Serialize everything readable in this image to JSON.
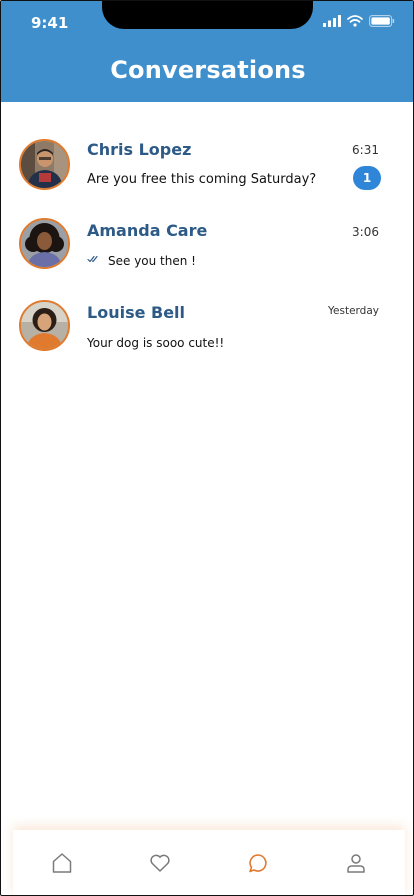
{
  "status_bar": {
    "time": "9:41"
  },
  "header": {
    "title": "Conversations"
  },
  "conversations": [
    {
      "name": "Chris Lopez",
      "message": "Are you free this coming Saturday?",
      "time": "6:31",
      "unread": "1"
    },
    {
      "name": "Amanda Care",
      "message": "See you then !",
      "time": "3:06",
      "read_receipt": "double-check-icon"
    },
    {
      "name": "Louise Bell",
      "message": "Your dog is sooo cute!!",
      "time": "Yesterday"
    }
  ],
  "nav": {
    "items": [
      "home-icon",
      "heart-icon",
      "chat-icon",
      "user-icon"
    ],
    "active": "chat-icon"
  },
  "colors": {
    "header": "#3f8fcd",
    "name": "#2d5a86",
    "badge": "#2f86d8",
    "accent": "#e07a2e",
    "nav_icon": "#7a7a7a"
  }
}
